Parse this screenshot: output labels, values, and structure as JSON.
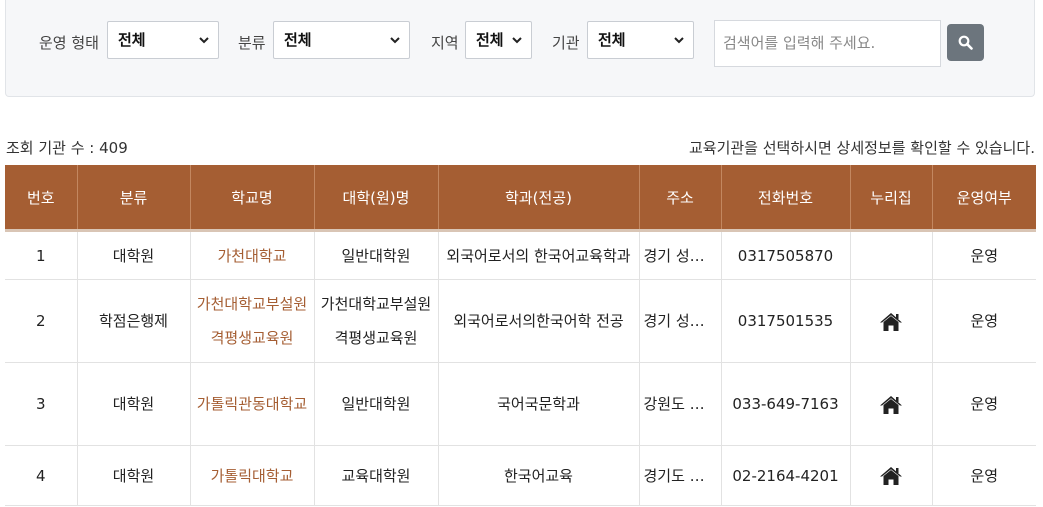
{
  "filters": {
    "operation_label": "운영 형태",
    "operation_value": "전체",
    "category_label": "분류",
    "category_value": "전체",
    "region_label": "지역",
    "region_value": "전체",
    "institution_label": "기관",
    "institution_value": "전체",
    "search_placeholder": "검색어를 입력해 주세요."
  },
  "summary": {
    "count_text": "조회 기관 수 : 409",
    "notice_text": "교육기관을 선택하시면 상세정보를 확인할 수 있습니다."
  },
  "table": {
    "headers": [
      "번호",
      "분류",
      "학교명",
      "대학(원)명",
      "학과(전공)",
      "주소",
      "전화번호",
      "누리집",
      "운영여부"
    ],
    "rows": [
      {
        "no": "1",
        "category": "대학원",
        "school": "가천대학교",
        "college": "일반대학원",
        "dept": "외국어로서의 한국어교육학과",
        "address": "경기 성남시",
        "phone": "0317505870",
        "homepage": false,
        "status": "운영"
      },
      {
        "no": "2",
        "category": "학점은행제",
        "school": "가천대학교부설원격평생교육원",
        "college": "가천대학교부설원격평생교육원",
        "dept": "외국어로서의한국어학 전공",
        "address": "경기 성남시",
        "phone": "0317501535",
        "homepage": true,
        "status": "운영"
      },
      {
        "no": "3",
        "category": "대학원",
        "school": "가톨릭관동대학교",
        "college": "일반대학원",
        "dept": "국어국문학과",
        "address": "강원도 강릉시",
        "phone": "033-649-7163",
        "homepage": true,
        "status": "운영"
      },
      {
        "no": "4",
        "category": "대학원",
        "school": "가톨릭대학교",
        "college": "교육대학원",
        "dept": "한국어교육",
        "address": "경기도 부천시",
        "phone": "02-2164-4201",
        "homepage": true,
        "status": "운영"
      }
    ]
  },
  "colors": {
    "header_bg": "#a55e33",
    "school_link": "#a55e33",
    "search_button": "#6c757d"
  }
}
